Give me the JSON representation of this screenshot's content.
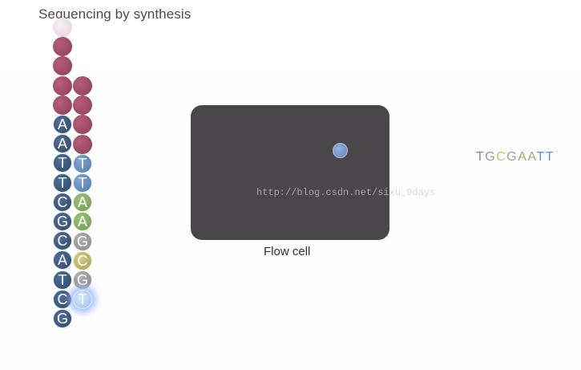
{
  "title": "Sequencing by synthesis",
  "flow_cell": {
    "label": "Flow cell",
    "cluster_color": "#6b8fc4"
  },
  "template_strand": {
    "adapter_beads": 5,
    "bases": [
      "A",
      "A",
      "T",
      "T",
      "C",
      "G",
      "C",
      "A",
      "T",
      "C",
      "G"
    ]
  },
  "synthesized_strand": {
    "adapter_beads": 4,
    "bases": [
      "T",
      "T",
      "A",
      "A",
      "G",
      "C",
      "G",
      "T"
    ],
    "incorporating_base": "T"
  },
  "read_sequence": {
    "letters": [
      {
        "char": "T",
        "color": "#6a8fc0"
      },
      {
        "char": "G",
        "color": "#9a9a9a"
      },
      {
        "char": "C",
        "color": "#c8bd6a"
      },
      {
        "char": "G",
        "color": "#9a9a9a"
      },
      {
        "char": "A",
        "color": "#8db368"
      },
      {
        "char": "A",
        "color": "#8db368"
      },
      {
        "char": "T",
        "color": "#6a8fc0"
      },
      {
        "char": "T",
        "color": "#6a8fc0"
      }
    ]
  },
  "colors": {
    "adapter": "#9e4a66",
    "base_A": "#7ea95c",
    "base_T": "#5f88bb",
    "base_C": "#b8ae62",
    "base_G": "#999999",
    "flow_cell": "#4a4649"
  },
  "watermark": "http://blog.csdn.net/sixu_9days"
}
